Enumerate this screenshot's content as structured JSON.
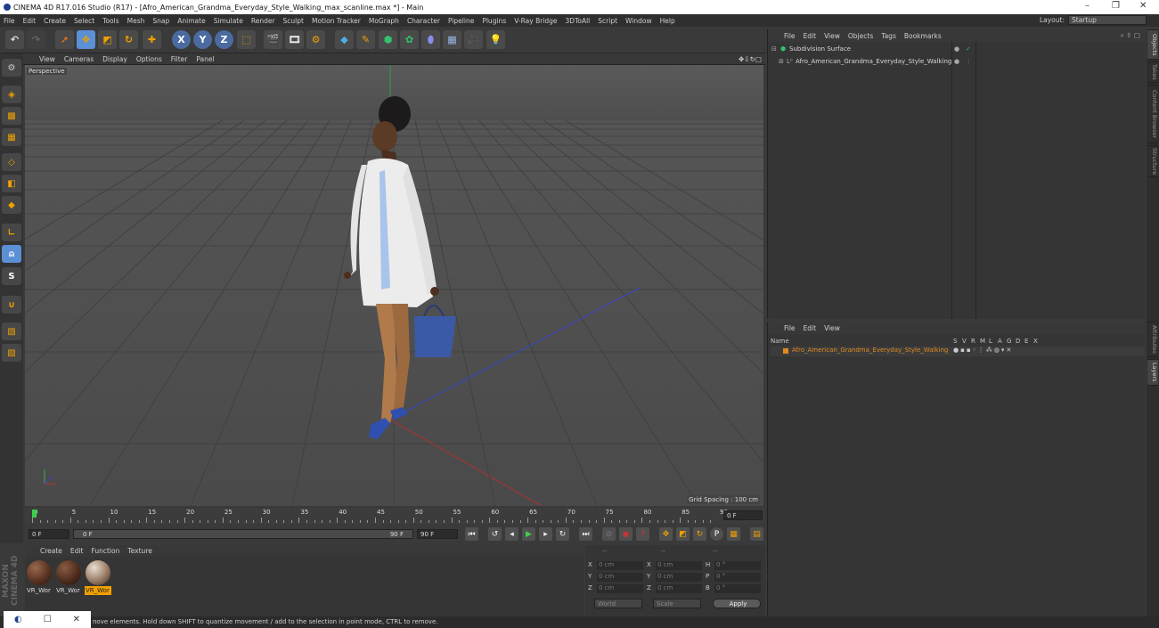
{
  "window": {
    "title": "CINEMA 4D R17.016 Studio (R17) - [Afro_American_Grandma_Everyday_Style_Walking_max_scanline.max *] - Main",
    "minimize": "–",
    "restore": "❐",
    "close": "✕"
  },
  "menubar": {
    "items": [
      "File",
      "Edit",
      "Create",
      "Select",
      "Tools",
      "Mesh",
      "Snap",
      "Animate",
      "Simulate",
      "Render",
      "Sculpt",
      "Motion Tracker",
      "MoGraph",
      "Character",
      "Pipeline",
      "Plugins",
      "V-Ray Bridge",
      "3DToAll",
      "Script",
      "Window",
      "Help"
    ],
    "layout_label": "Layout:",
    "layout_value": "Startup"
  },
  "toolbar": {
    "axis_x": "X",
    "axis_y": "Y",
    "axis_z": "Z"
  },
  "left_tools": {
    "s_label": "S"
  },
  "viewport": {
    "menu": [
      "View",
      "Cameras",
      "Display",
      "Options",
      "Filter",
      "Panel"
    ],
    "label": "Perspective",
    "grid_spacing": "Grid Spacing : 100 cm"
  },
  "timeline": {
    "ticks": [
      "0",
      "5",
      "10",
      "15",
      "20",
      "25",
      "30",
      "35",
      "40",
      "45",
      "50",
      "55",
      "60",
      "65",
      "70",
      "75",
      "80",
      "85",
      "90"
    ],
    "current_frame": "0 F"
  },
  "controls": {
    "start_field": "0 F",
    "range_start": "0 F",
    "range_end": "90 F",
    "end_field": "90 F"
  },
  "materials": {
    "menu": [
      "Create",
      "Edit",
      "Function",
      "Texture"
    ],
    "items": [
      {
        "label": "VR_Wor",
        "selected": false,
        "color": "#5a3422"
      },
      {
        "label": "VR_Wor",
        "selected": false,
        "color": "#4e2d1f"
      },
      {
        "label": "VR_Wor",
        "selected": true,
        "color": "#9a7c66"
      }
    ]
  },
  "coordinates": {
    "header_left": "--",
    "header_mid": "--",
    "header_right": "--",
    "rows": [
      {
        "a": "X",
        "av": "0 cm",
        "b": "X",
        "bv": "0 cm",
        "c": "H",
        "cv": "0 °"
      },
      {
        "a": "Y",
        "av": "0 cm",
        "b": "Y",
        "bv": "0 cm",
        "c": "P",
        "cv": "0 °"
      },
      {
        "a": "Z",
        "av": "0 cm",
        "b": "Z",
        "bv": "0 cm",
        "c": "B",
        "cv": "0 °"
      }
    ],
    "mode": "World",
    "scale": "Scale",
    "apply": "Apply"
  },
  "object_manager": {
    "menu": [
      "File",
      "Edit",
      "View",
      "Objects",
      "Tags",
      "Bookmarks"
    ],
    "objects": [
      {
        "name": "Subdivision Surface"
      },
      {
        "name": "Afro_American_Grandma_Everyday_Style_Walking"
      }
    ]
  },
  "layer_manager": {
    "menu": [
      "File",
      "Edit",
      "View"
    ],
    "col_name": "Name",
    "col_flags": [
      "S",
      "V",
      "R",
      "M",
      "L",
      "A",
      "G",
      "D",
      "E",
      "X"
    ],
    "layers": [
      {
        "name": "Afro_American_Grandma_Everyday_Style_Walking",
        "color": "#e08a1e"
      }
    ]
  },
  "side_tabs": [
    "Objects",
    "Takes",
    "Content Browser",
    "Structure",
    "Attributes",
    "Layers"
  ],
  "status": {
    "text": "Move: Click and drag to move elements. Hold down SHIFT to quantize movement / add to the selection in point mode, CTRL to remove.",
    "visible_text": "nove elements. Hold down SHIFT to quantize movement / add to the selection in point mode, CTRL to remove."
  },
  "colors": {
    "accent_orange": "#f0a000",
    "selection_blue": "#5b8fd6",
    "layer_orange": "#e08a1e"
  }
}
